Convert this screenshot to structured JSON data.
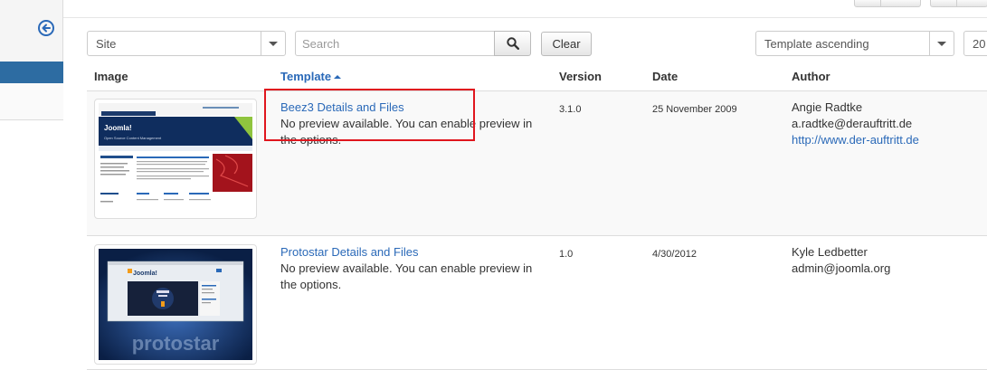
{
  "filters": {
    "site_select": "Site",
    "search_placeholder": "Search",
    "clear_label": "Clear",
    "order_select": "Template ascending",
    "limit_select": "20"
  },
  "table": {
    "headers": {
      "image": "Image",
      "template": "Template",
      "version": "Version",
      "date": "Date",
      "author": "Author"
    },
    "rows": [
      {
        "name": "Beez3 Details and Files",
        "preview_note_line1": "No preview available. You can enable preview in",
        "preview_note_line2": "the options.",
        "version": "3.1.0",
        "date": "25 November 2009",
        "author_name": "Angie Radtke",
        "author_email": "a.radtke@derauftritt.de",
        "author_url": "http://www.der-auftritt.de",
        "thumb_brand": "Joomla!",
        "thumb_tagline": "Open Source Content Management"
      },
      {
        "name": "Protostar Details and Files",
        "preview_note_line1": "No preview available. You can enable preview in",
        "preview_note_line2": "the options.",
        "version": "1.0",
        "date": "4/30/2012",
        "author_name": "Kyle Ledbetter",
        "author_email": "admin@joomla.org",
        "thumb_brand": "Joomla!",
        "thumb_word": "protostar"
      }
    ]
  },
  "colors": {
    "link": "#2a69b8",
    "sidebar_active": "#2d6ca2",
    "highlight": "#e0161e"
  },
  "icons": {
    "sidebar_toggle": "arrow-left-circle-icon",
    "search": "search-icon",
    "sort": "caret-up-icon"
  }
}
